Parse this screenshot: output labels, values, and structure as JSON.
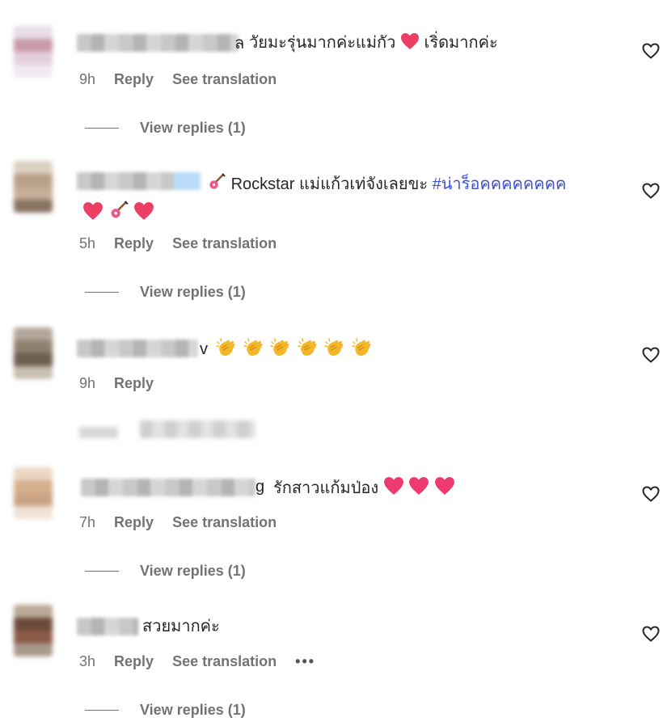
{
  "comments": [
    {
      "tail_text": "ล",
      "text": "วัยมะรุ่นมากค่ะแม่กัว",
      "text_after_emoji": "เริ่ดมากค่ะ",
      "time": "9h",
      "reply_label": "Reply",
      "translation_label": "See translation",
      "replies_label": "View replies (1)",
      "like_icon": "heart-outline-icon"
    },
    {
      "text": "Rockstar แม่แก้วเท่จังเลยขะ",
      "hashtag": "#น่าร็อคคคคคคคค",
      "time": "5h",
      "reply_label": "Reply",
      "translation_label": "See translation",
      "replies_label": "View replies (1)",
      "like_icon": "heart-outline-icon"
    },
    {
      "tail_text": "v",
      "time": "9h",
      "reply_label": "Reply",
      "like_icon": "heart-outline-icon"
    },
    {
      "tail_text": "g",
      "text": "รักสาวแก้มป่อง",
      "time": "7h",
      "reply_label": "Reply",
      "translation_label": "See translation",
      "replies_label": "View replies (1)",
      "like_icon": "heart-outline-icon"
    },
    {
      "text": "สวยมากค่ะ",
      "time": "3h",
      "reply_label": "Reply",
      "translation_label": "See translation",
      "more_label": "•••",
      "replies_label": "View replies (1)",
      "like_icon": "heart-outline-icon"
    }
  ],
  "colors": {
    "text": "#262626",
    "muted": "#737373",
    "hashtag": "#3f51d9",
    "heart": "#ed3e63"
  }
}
